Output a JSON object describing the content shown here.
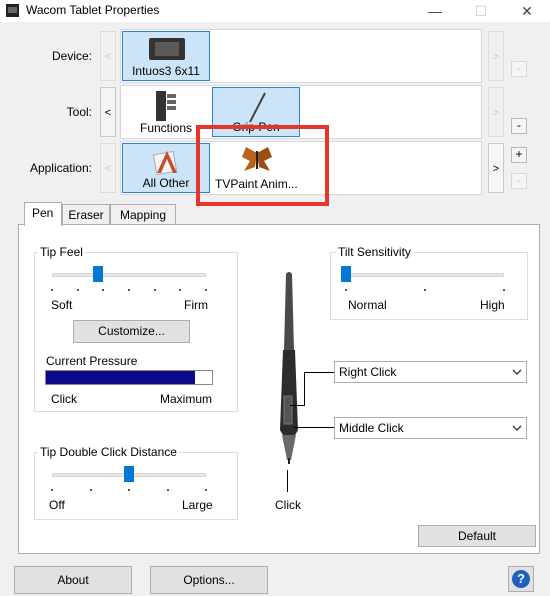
{
  "window": {
    "title": "Wacom Tablet Properties",
    "minimize": "—",
    "maximize": "☐",
    "close": "✕"
  },
  "device": {
    "label": "Device:",
    "items": [
      "Intuos3 6x11"
    ]
  },
  "tool": {
    "label": "Tool:",
    "items": [
      "Functions",
      "Grip Pen"
    ]
  },
  "application": {
    "label": "Application:",
    "items": [
      "All Other",
      "TVPaint Anim..."
    ]
  },
  "nav": {
    "left": "<",
    "right": ">",
    "add": "+",
    "remove": "-"
  },
  "tabs": [
    "Pen",
    "Eraser",
    "Mapping"
  ],
  "tip_feel": {
    "title": "Tip Feel",
    "level": 0.3,
    "min_label": "Soft",
    "max_label": "Firm",
    "customize": "Customize...",
    "pressure_title": "Current Pressure",
    "pressure_level": 0.9,
    "pressure_min": "Click",
    "pressure_max": "Maximum"
  },
  "tilt": {
    "title": "Tilt Sensitivity",
    "level": 0.0,
    "min_label": "Normal",
    "max_label": "High"
  },
  "double_click": {
    "title": "Tip Double Click Distance",
    "level": 0.5,
    "min_label": "Off",
    "max_label": "Large"
  },
  "pen_buttons": {
    "upper": "Right Click",
    "lower": "Middle Click",
    "tip": "Click"
  },
  "buttons": {
    "default": "Default",
    "about": "About",
    "options": "Options..."
  },
  "help": "?",
  "colors": {
    "accent": "#0078d7",
    "highlight": "#e5352c",
    "selection": "#cce4f7",
    "pressure": "#0a0a8a"
  }
}
